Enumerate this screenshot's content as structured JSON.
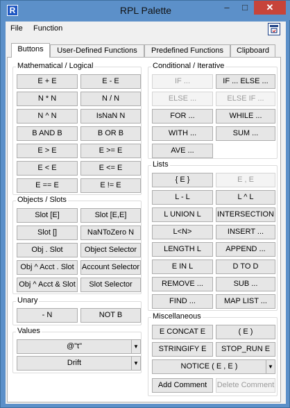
{
  "window": {
    "title": "RPL Palette",
    "app_icon_glyph": "R",
    "minimize_glyph": "–",
    "maximize_glyph": "□",
    "close_glyph": "✕"
  },
  "menu": {
    "file": "File",
    "function": "Function"
  },
  "tabs": [
    "Buttons",
    "User-Defined Functions",
    "Predefined Functions",
    "Clipboard"
  ],
  "active_tab": "Buttons",
  "groups": {
    "math": {
      "label": "Mathematical / Logical",
      "buttons": [
        "E + E",
        "E - E",
        "N * N",
        "N / N",
        "N ^ N",
        "IsNaN N",
        "B AND B",
        "B OR B",
        "E > E",
        "E >= E",
        "E < E",
        "E <= E",
        "E == E",
        "E != E"
      ]
    },
    "objects": {
      "label": "Objects / Slots",
      "buttons": [
        "Slot [E]",
        "Slot [E,E]",
        "Slot []",
        "NaNToZero N",
        "Obj . Slot",
        "Object Selector",
        "Obj ^ Acct . Slot",
        "Account Selector",
        "Obj ^ Acct & Slot",
        "Slot Selector"
      ]
    },
    "unary": {
      "label": "Unary",
      "buttons": [
        "- N",
        "NOT B"
      ]
    },
    "values": {
      "label": "Values",
      "combo1": "@\"t\"",
      "combo2": "Drift"
    },
    "conditional": {
      "label": "Conditional / Iterative",
      "buttons": [
        "IF ...",
        "IF ... ELSE ...",
        "ELSE ...",
        "ELSE IF ...",
        "FOR ...",
        "WHILE ...",
        "WITH ...",
        "SUM ...",
        "AVE ..."
      ]
    },
    "lists": {
      "label": "Lists",
      "buttons": [
        "{ E }",
        "E , E",
        "L - L",
        "L ^ L",
        "L UNION L",
        "INTERSECTION",
        "L<N>",
        "INSERT ...",
        "LENGTH L",
        "APPEND ...",
        "E IN L",
        "D TO D",
        "REMOVE ...",
        "SUB ...",
        "FIND ...",
        "MAP LIST ..."
      ]
    },
    "misc": {
      "label": "Miscellaneous",
      "buttons": [
        "E CONCAT E",
        "( E )",
        "STRINGIFY E",
        "STOP_RUN E"
      ],
      "notice_combo": "NOTICE ( E , E )",
      "add_comment": "Add Comment",
      "delete_comment": "Delete Comment"
    }
  },
  "dropdown_arrow_glyph": "▼"
}
